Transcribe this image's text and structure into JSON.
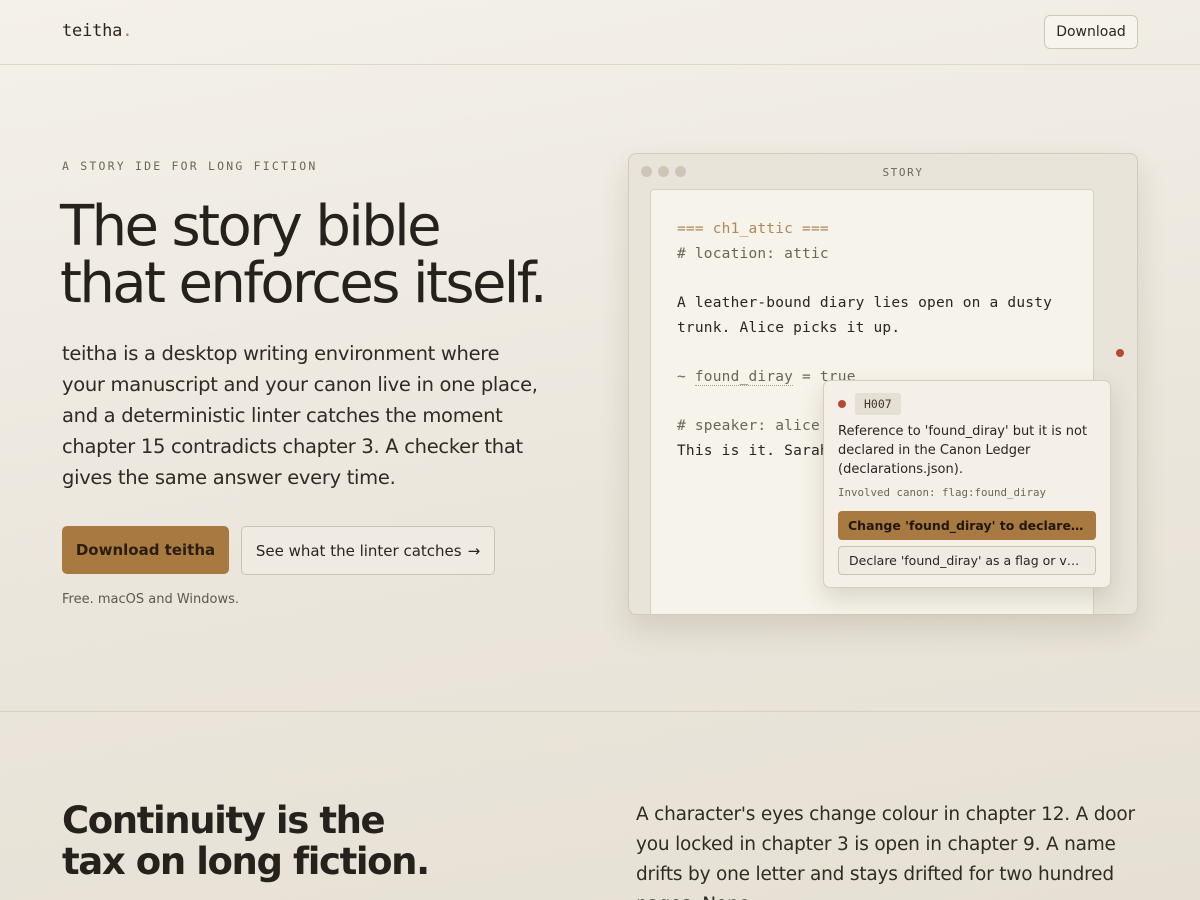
{
  "header": {
    "logo_text": "teitha",
    "logo_dot": ".",
    "download_label": "Download"
  },
  "hero": {
    "eyebrow": "A STORY IDE FOR LONG FICTION",
    "title_line1": "The story bible",
    "title_line2": "that enforces itself.",
    "description": "teitha is a desktop writing environment where your manuscript and your canon live in one place, and a deterministic linter catches the moment chapter 15 contradicts chapter 3. A checker that gives the same answer every time.",
    "primary_cta": "Download teitha",
    "secondary_cta": "See what the linter catches",
    "secondary_arrow": "→",
    "fine_print": "Free. macOS and Windows."
  },
  "editor_window": {
    "title": "STORY",
    "lines": {
      "knot": "=== ch1_attic ===",
      "location_tag": "# location: attic",
      "prose1": "A leather-bound diary lies open on a dusty",
      "prose2": "trunk. Alice picks it up.",
      "assign_prefix": "~ ",
      "assign_var": "found_diray",
      "assign_suffix": " = true",
      "speaker_tag": "# speaker: alice",
      "dialogue": "This is it. Sarah"
    }
  },
  "lint_popover": {
    "code": "H007",
    "message": "Reference to 'found_diray' but it is not declared in the Canon Ledger (declarations.json).",
    "involved": "Involved canon: flag:found_diray",
    "fix_primary": "Change 'found_diray' to declared 'foun...",
    "fix_secondary": "Declare 'found_diray' as a flag or variabl..."
  },
  "section2": {
    "title_line1": "Continuity is the",
    "title_line2": "tax on long fiction.",
    "body": "A character's eyes change colour in chapter 12. A door you locked in chapter 3 is open in chapter 9. A name drifts by one letter and stays drifted for two hundred pages. None"
  },
  "colors": {
    "accent": "#a87a42",
    "error": "#b44a36",
    "background": "#efebe3"
  }
}
